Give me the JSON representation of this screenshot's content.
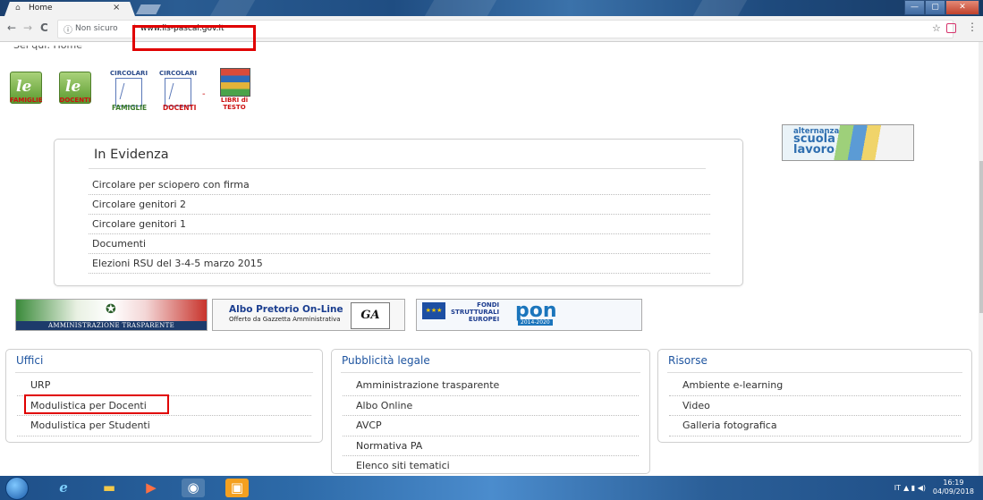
{
  "browser": {
    "tab_title": "Home",
    "tab_close": "×",
    "secure_label": "Non sicuro",
    "url": "www.iis-pascal.gov.it",
    "back": "←",
    "forward": "→",
    "reload": "C",
    "star": "☆",
    "menu": "⋮",
    "window_controls": [
      "—",
      "▢",
      "✕"
    ]
  },
  "page": {
    "breadcrumb": "Sei qui:  Home",
    "quick_links": {
      "famiglie": "FAMIGLIE",
      "docenti": "DOCENTI",
      "circolari": "CIRCOLARI",
      "circolari_famiglie": "FAMIGLIE",
      "circolari_docenti": "DOCENTI",
      "separator": "-",
      "libri_line1": "LIBRI di",
      "libri_line2": "TESTO"
    },
    "alternanza": {
      "line1": "alternanza",
      "line2": "scuola",
      "line3": "lavoro"
    },
    "in_evidenza": {
      "title": "In Evidenza",
      "items": [
        "Circolare per sciopero con firma",
        "Circolare genitori 2",
        "Circolare genitori 1",
        "Documenti",
        "Elezioni RSU del 3-4-5 marzo 2015"
      ]
    },
    "banners": {
      "amministrazione": "AMMINISTRAZIONE TRASPARENTE",
      "albo_title": "Albo Pretorio On-Line",
      "albo_sub": "Offerto da Gazzetta Amministrativa",
      "albo_logo": "GA",
      "fondi_l1": "FONDI",
      "fondi_l2": "STRUTTURALI",
      "fondi_l3": "EUROPEI",
      "pon": "pon",
      "pon_years": "2014-2020"
    },
    "columns": {
      "uffici": {
        "title": "Uffici",
        "items": [
          "URP",
          "Modulistica per Docenti",
          "Modulistica per Studenti"
        ]
      },
      "pubblicita": {
        "title": "Pubblicità legale",
        "items": [
          "Amministrazione trasparente",
          "Albo Online",
          "AVCP",
          "Normativa PA",
          "Elenco siti tematici"
        ]
      },
      "risorse": {
        "title": "Risorse",
        "items": [
          "Ambiente e-learning",
          "Video",
          "Galleria fotografica"
        ]
      }
    }
  },
  "taskbar": {
    "lang": "IT",
    "time": "16:19",
    "date": "04/09/2018"
  },
  "colors": {
    "highlight_red": "#e00000",
    "heading_blue": "#1f55a0",
    "taskbar_blue": "#2d6aa8"
  }
}
